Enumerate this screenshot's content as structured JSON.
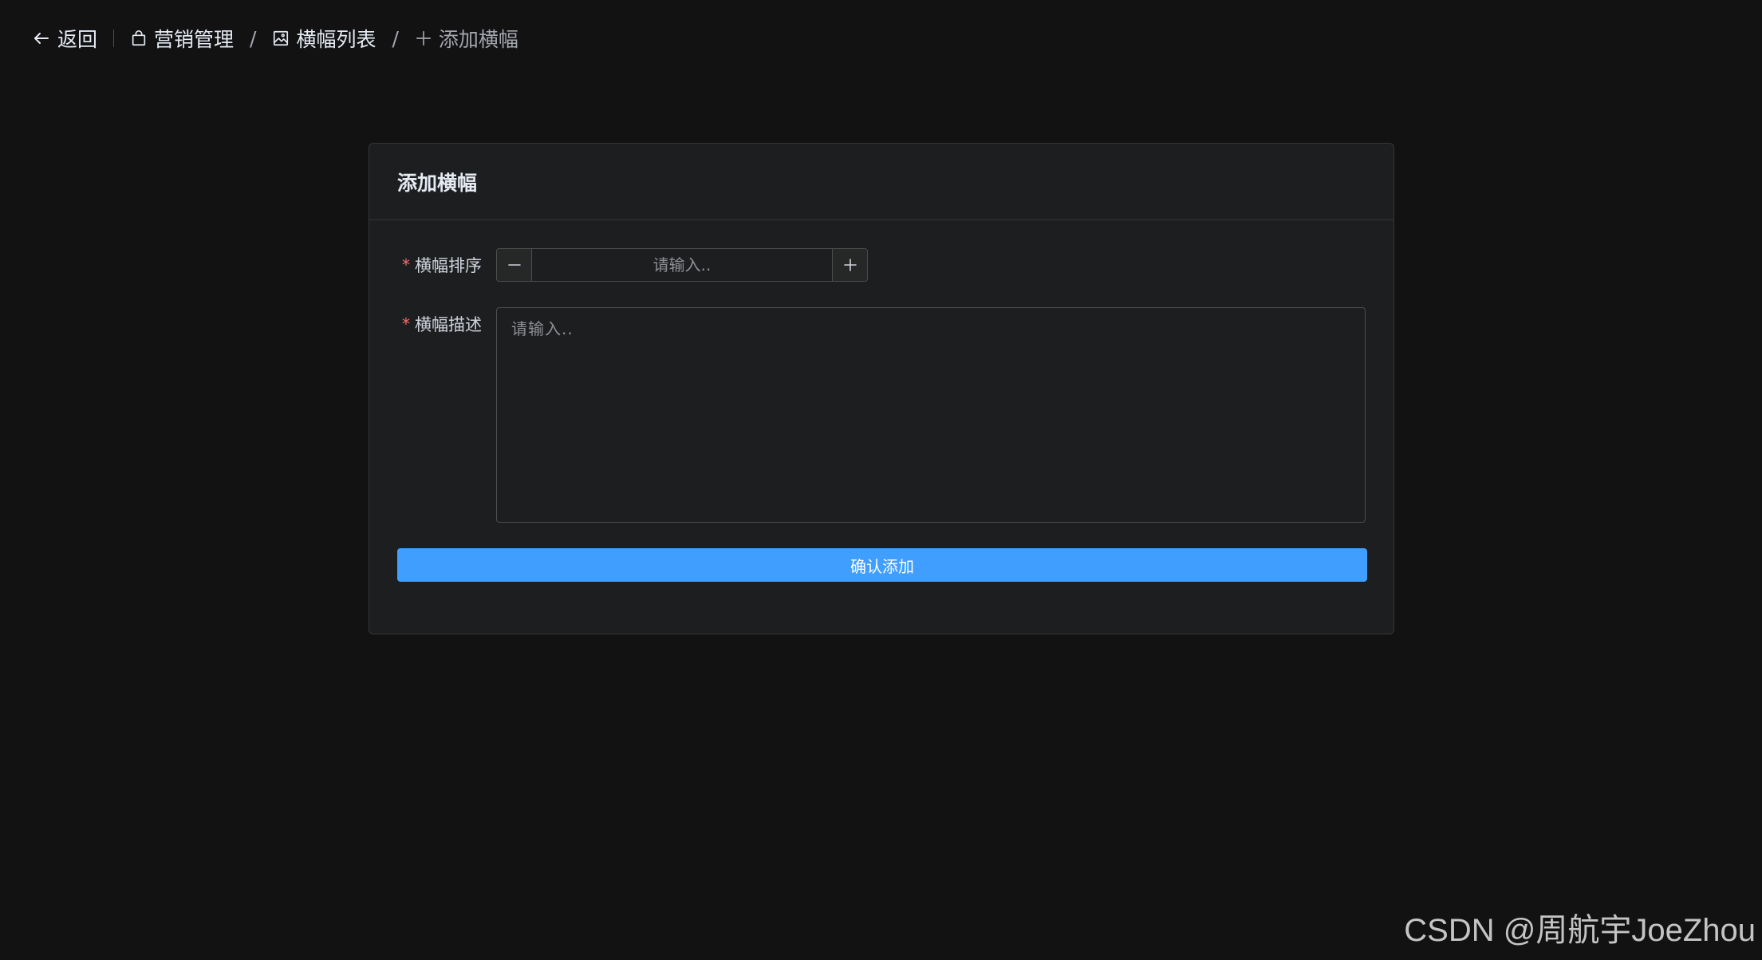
{
  "header": {
    "back_label": "返回",
    "breadcrumbs": [
      {
        "label": "营销管理",
        "icon": "shopping-bag-icon"
      },
      {
        "label": "横幅列表",
        "icon": "picture-icon"
      },
      {
        "label": "添加横幅",
        "icon": "plus-icon"
      }
    ],
    "separator": "/"
  },
  "card": {
    "title": "添加横幅"
  },
  "form": {
    "required_mark": "*",
    "order": {
      "label": "横幅排序",
      "placeholder": "请输入.."
    },
    "description": {
      "label": "横幅描述",
      "placeholder": "请输入.."
    },
    "submit_label": "确认添加"
  },
  "watermark": "CSDN @周航宇JoeZhou",
  "colors": {
    "background": "#121213",
    "card": "#1d1e1f",
    "primary": "#409eff",
    "required": "#f56c6c"
  }
}
